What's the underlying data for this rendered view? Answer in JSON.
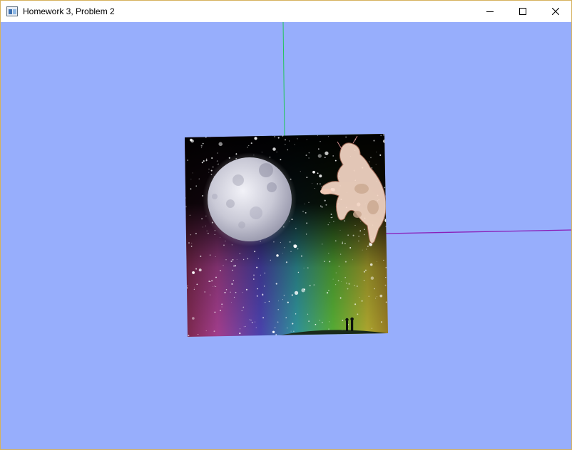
{
  "window": {
    "title": "Homework 3, Problem 2",
    "icon": "app-window-icon",
    "controls": [
      "minimize-icon",
      "maximize-icon",
      "close-icon"
    ]
  },
  "scene": {
    "background_color": "#97aefc",
    "axes": {
      "y_axis_color": "#22c65a",
      "x_axis_color": "#8a1fb8"
    },
    "textured_quad": {
      "texture": "moon-cow-rainbow-starfield",
      "elements": [
        "moon",
        "cow",
        "stars",
        "rainbow",
        "hill",
        "two-silhouettes"
      ]
    }
  }
}
